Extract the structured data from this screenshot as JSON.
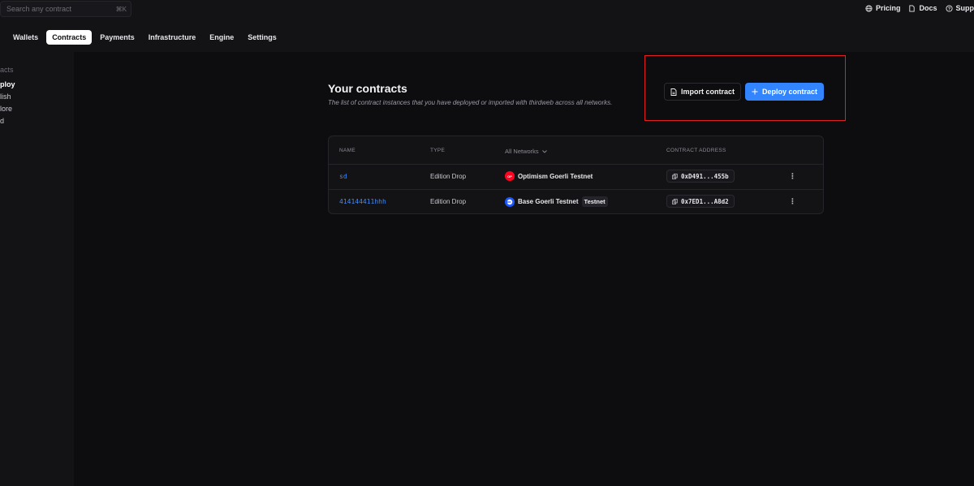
{
  "search": {
    "placeholder": "Search any contract",
    "shortcut": "⌘K"
  },
  "top_links": [
    {
      "label": "Pricing",
      "icon": "globe-icon"
    },
    {
      "label": "Docs",
      "icon": "document-icon"
    },
    {
      "label": "Supp",
      "icon": "help-icon"
    }
  ],
  "tabs": [
    "Wallets",
    "Contracts",
    "Payments",
    "Infrastructure",
    "Engine",
    "Settings"
  ],
  "active_tab": "Contracts",
  "sidebar": {
    "items": [
      {
        "label": "acts"
      },
      {
        "label": "ploy"
      },
      {
        "label": "lish"
      },
      {
        "label": "lore"
      },
      {
        "label": "d"
      }
    ]
  },
  "page": {
    "title": "Your contracts",
    "subtitle": "The list of contract instances that you have deployed or imported with thirdweb across all networks."
  },
  "actions": {
    "import_label": "Import contract",
    "deploy_label": "Deploy contract"
  },
  "table": {
    "headers": {
      "name": "NAME",
      "type": "TYPE",
      "network": "All Networks",
      "address": "CONTRACT ADDRESS"
    },
    "rows": [
      {
        "name": "sd",
        "type": "Edition Drop",
        "network": "Optimism Goerli Testnet",
        "network_badge": "",
        "chain_icon": "OP",
        "address": "0xD491...455b"
      },
      {
        "name": "414144411hhh",
        "type": "Edition Drop",
        "network": "Base Goerli Testnet",
        "network_badge": "Testnet",
        "chain_icon": "",
        "address": "0x7ED1...A8d2"
      }
    ]
  },
  "colors": {
    "accent": "#3385ff",
    "highlight": "#e02020",
    "background": "#0d0d10",
    "surface": "#131316"
  }
}
